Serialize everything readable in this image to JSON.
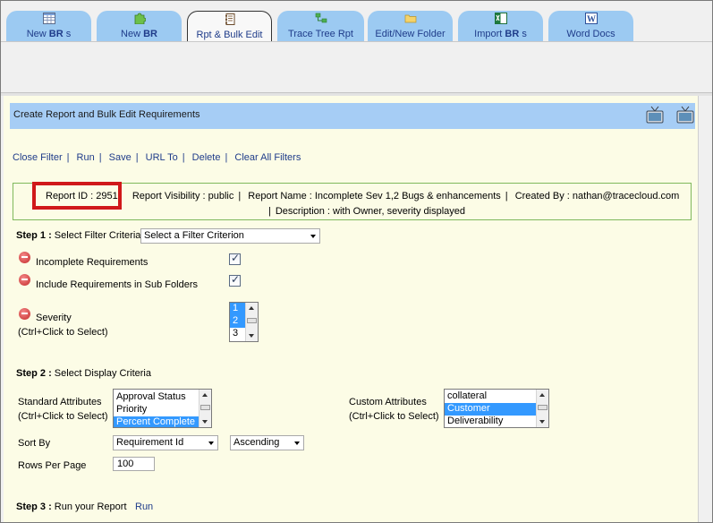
{
  "tabs": [
    {
      "prefix": "New ",
      "bold": "BR",
      "suffix": " s",
      "icon": "list-icon"
    },
    {
      "prefix": "New ",
      "bold": "BR",
      "suffix": "",
      "icon": "puzzle-icon"
    },
    {
      "prefix": "Rpt & Bulk Edit",
      "bold": "",
      "suffix": "",
      "icon": "notebook-icon"
    },
    {
      "prefix": "Trace Tree Rpt",
      "bold": "",
      "suffix": "",
      "icon": "tree-icon"
    },
    {
      "prefix": "Edit/New Folder",
      "bold": "",
      "suffix": "",
      "icon": "folder-icon"
    },
    {
      "prefix": "Import ",
      "bold": "BR",
      "suffix": " s",
      "icon": "excel-icon"
    },
    {
      "prefix": "Word Docs",
      "bold": "",
      "suffix": "",
      "icon": "word-icon"
    }
  ],
  "header": {
    "title": "Create Report and Bulk Edit Requirements"
  },
  "actions": [
    "Close Filter",
    "Run",
    "Save",
    "URL To",
    "Delete",
    "Clear All Filters"
  ],
  "report": {
    "id": "Report ID : 2951",
    "visibility": "Report Visibility : public",
    "name": "Report Name : Incomplete Sev 1,2 Bugs & enhancements",
    "created_by": "Created By : nathan@tracecloud.com",
    "description": "Description : with Owner, severity displayed"
  },
  "step1": {
    "label": "Step 1 :",
    "text": "Select Filter Criteria",
    "select_value": "Select a Filter Criterion",
    "filters": {
      "incomplete": "Incomplete Requirements",
      "subfolders": "Include Requirements in Sub Folders",
      "severity": "Severity",
      "severity_hint": "(Ctrl+Click to Select)",
      "severity_options": [
        "1",
        "2",
        "3"
      ]
    }
  },
  "step2": {
    "label": "Step 2 :",
    "text": "Select Display Criteria",
    "standard_label": "Standard Attributes",
    "standard_hint": "(Ctrl+Click to Select)",
    "standard_options": [
      "Approval Status",
      "Priority",
      "Percent Complete"
    ],
    "custom_label": "Custom Attributes",
    "custom_hint": "(Ctrl+Click to Select)",
    "custom_options": [
      "collateral",
      "Customer",
      "Deliverability"
    ],
    "sort_by_label": "Sort By",
    "sort_by_value": "Requirement Id",
    "sort_order_value": "Ascending",
    "rows_label": "Rows Per Page",
    "rows_value": "100"
  },
  "step3": {
    "label": "Step 3 :",
    "text": "Run your Report",
    "run": "Run"
  },
  "colors": {
    "tab": "#9ccaf2",
    "header": "#a6cdf5",
    "panel": "#fcfce6",
    "link": "#1f3c8a",
    "highlight": "#d0181a"
  }
}
